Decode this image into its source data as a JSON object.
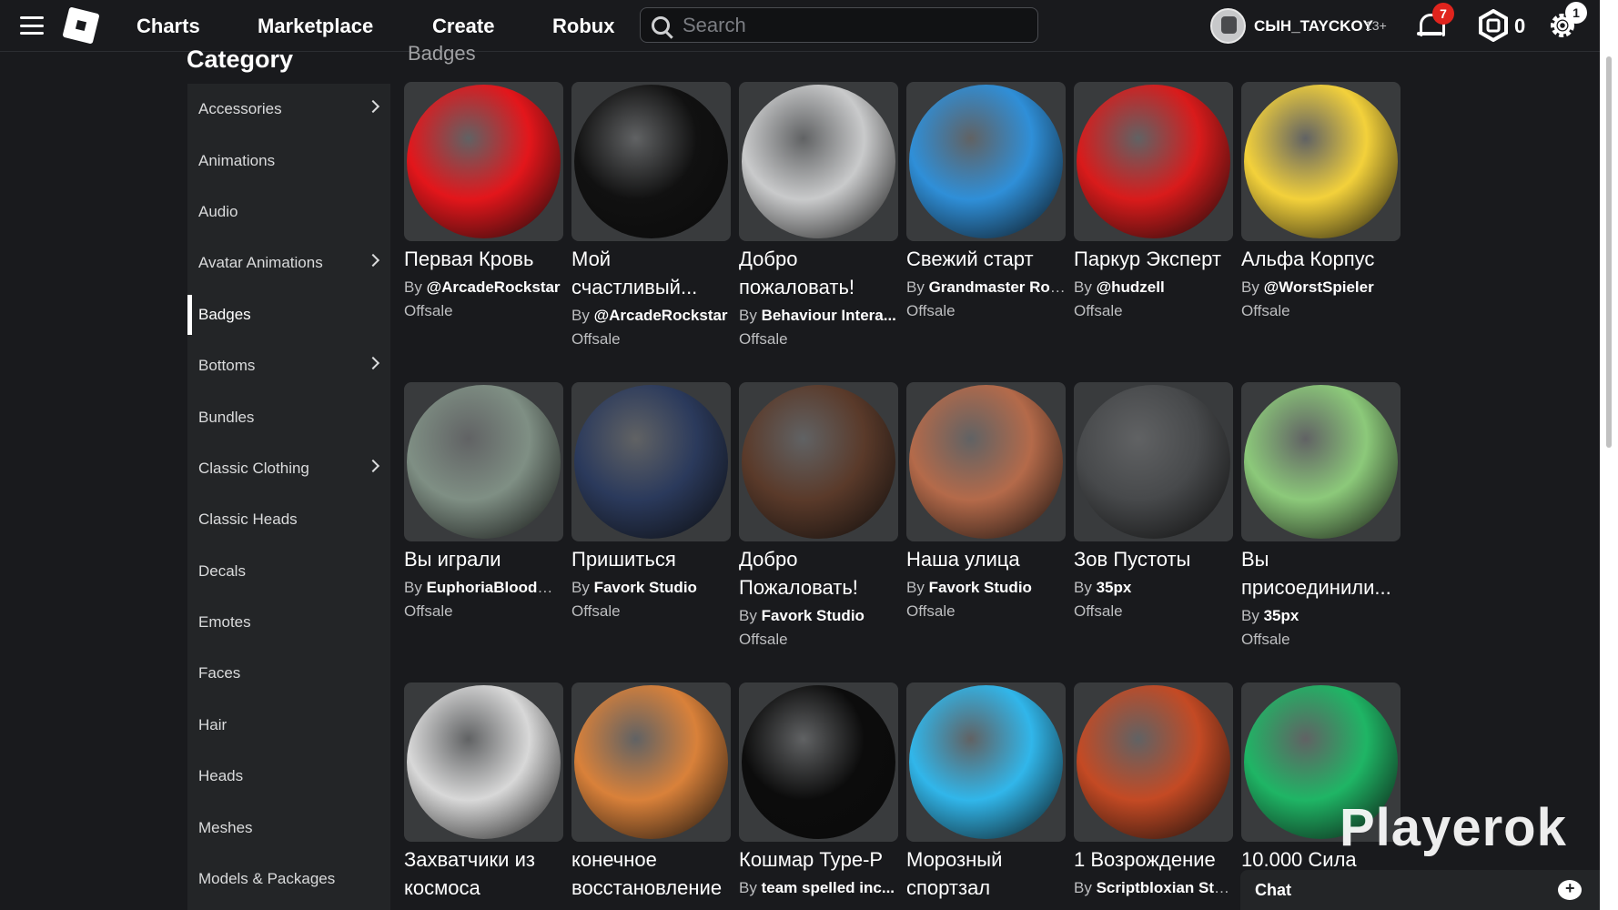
{
  "nav": {
    "links": [
      "Charts",
      "Marketplace",
      "Create",
      "Robux"
    ],
    "search_placeholder": "Search",
    "username": "CЫН_TAYCKOY",
    "age_label": "13+",
    "notifications_count": "7",
    "robux_count": "0",
    "settings_count": "1"
  },
  "sidebar": {
    "title": "Category",
    "items": [
      {
        "label": "Accessories",
        "has_submenu": true
      },
      {
        "label": "Animations",
        "has_submenu": false
      },
      {
        "label": "Audio",
        "has_submenu": false
      },
      {
        "label": "Avatar Animations",
        "has_submenu": true
      },
      {
        "label": "Badges",
        "has_submenu": false,
        "active": true
      },
      {
        "label": "Bottoms",
        "has_submenu": true
      },
      {
        "label": "Bundles",
        "has_submenu": false
      },
      {
        "label": "Classic Clothing",
        "has_submenu": true
      },
      {
        "label": "Classic Heads",
        "has_submenu": false
      },
      {
        "label": "Decals",
        "has_submenu": false
      },
      {
        "label": "Emotes",
        "has_submenu": false
      },
      {
        "label": "Faces",
        "has_submenu": false
      },
      {
        "label": "Hair",
        "has_submenu": false
      },
      {
        "label": "Heads",
        "has_submenu": false
      },
      {
        "label": "Meshes",
        "has_submenu": false
      },
      {
        "label": "Models & Packages",
        "has_submenu": false
      }
    ]
  },
  "main": {
    "section_title": "Badges",
    "by_prefix": "By",
    "items": [
      {
        "title": "Первая Кровь",
        "creator": "@ArcadeRockstar",
        "price": "Offsale",
        "icon": "blood-drop-badge",
        "color": "#e3161b"
      },
      {
        "title": "Мой счастливый...",
        "creator": "@ArcadeRockstar",
        "price": "Offsale",
        "icon": "revolver-cylinder-badge",
        "color": "#111111"
      },
      {
        "title": "Добро пожаловать!",
        "creator": "Behaviour Intera...",
        "price": "Offsale",
        "icon": "restroom-2-badge",
        "color": "#c9cacb"
      },
      {
        "title": "Свежий старт",
        "creator": "Grandmaster Roo...",
        "price": "Offsale",
        "icon": "fresh-start-badge",
        "color": "#2f8fd8"
      },
      {
        "title": "Паркур Эксперт",
        "creator": "@hudzell",
        "price": "Offsale",
        "icon": "parkour-logo-badge",
        "color": "#d91b1b"
      },
      {
        "title": "Альфа Корпус",
        "creator": "@WorstSpieler",
        "price": "Offsale",
        "icon": "alpha-corps-badge",
        "color": "#f3d13b"
      },
      {
        "title": "Вы играли",
        "creator": "EuphoriaBloodRa...",
        "price": "Offsale",
        "icon": "npc-sad-face-badge",
        "color": "#7f8f84"
      },
      {
        "title": "Пришиться",
        "creator": "Favork Studio",
        "price": "Offsale",
        "icon": "dark-portrait-badge",
        "color": "#2b3a5c"
      },
      {
        "title": "Добро Пожаловать!",
        "creator": "Favork Studio",
        "price": "Offsale",
        "icon": "hat-character-badge",
        "color": "#5a3a2a"
      },
      {
        "title": "Наша улица",
        "creator": "Favork Studio",
        "price": "Offsale",
        "icon": "house-badge",
        "color": "#b46a4a"
      },
      {
        "title": "Зов Пустоты",
        "creator": "35px",
        "price": "Offsale",
        "icon": "void-badge",
        "color": "#47494b"
      },
      {
        "title": "Вы присоединили...",
        "creator": "35px",
        "price": "Offsale",
        "icon": "you-joined-badge",
        "color": "#8cc97a"
      },
      {
        "title": "Захватчики из космоса",
        "creator": "",
        "price": "",
        "icon": "alien-face-badge",
        "color": "#d8d8d8"
      },
      {
        "title": "конечное восстановление",
        "creator": "",
        "price": "",
        "icon": "glowing-fists-badge",
        "color": "#d9813a"
      },
      {
        "title": "Кошмар Type-P",
        "creator": "team spelled inc...",
        "price": "",
        "icon": "dark-void-badge",
        "color": "#0c0c0c"
      },
      {
        "title": "Морозный спортзал",
        "creator": "",
        "price": "",
        "icon": "frost-gym-badge",
        "color": "#31b6ea"
      },
      {
        "title": "1 Возрождение",
        "creator": "Scriptbloxian Stu...",
        "price": "",
        "icon": "rebirth-badge",
        "color": "#c44a24"
      },
      {
        "title": "10.000 Сила",
        "creator": "",
        "price": "",
        "icon": "strength-badge",
        "color": "#1fb565"
      }
    ]
  },
  "watermark": "Playerok",
  "chat": {
    "label": "Chat"
  }
}
